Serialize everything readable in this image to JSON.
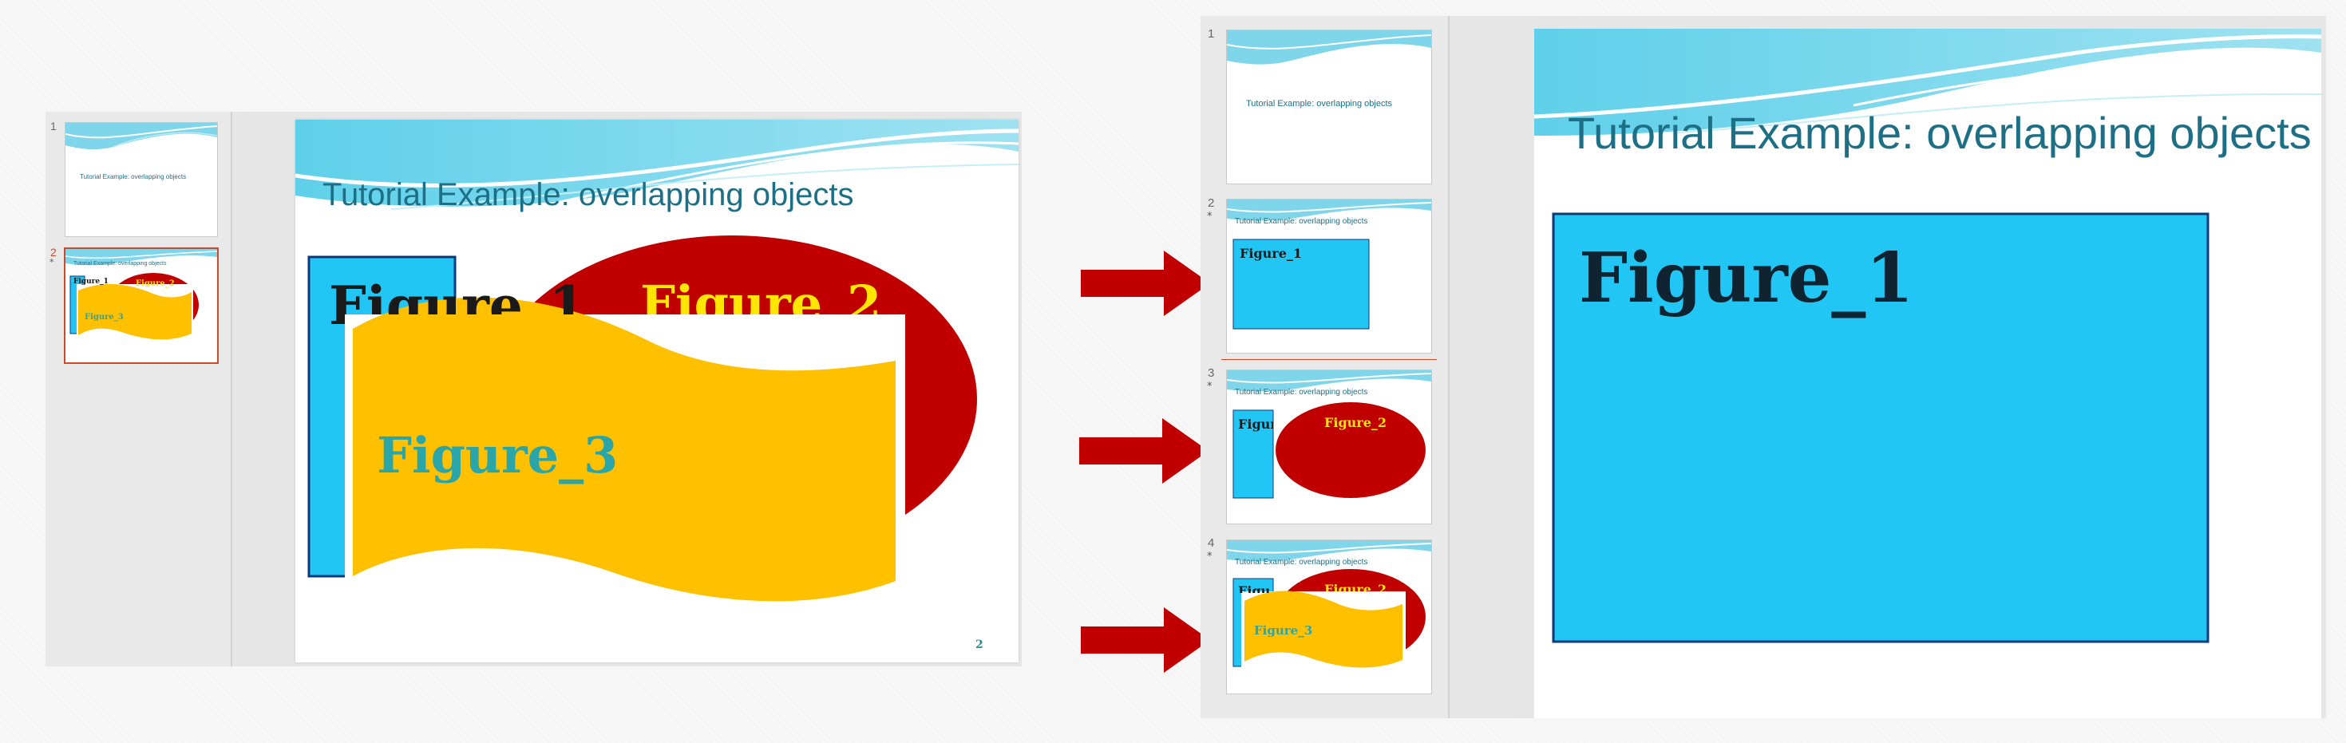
{
  "common": {
    "slide_title": "Tutorial Example: overlapping objects",
    "figure_1": "Figure_1",
    "figure_2": "Figure_2",
    "figure_3": "Figure_3",
    "page_number_2": "2"
  },
  "left_editor": {
    "thumbnails": [
      {
        "number": "1",
        "selected": false
      },
      {
        "number": "2",
        "selected": true,
        "has_animation": "*"
      }
    ]
  },
  "right_editor": {
    "thumbnails": [
      {
        "number": "1"
      },
      {
        "number": "2",
        "has_animation": "*"
      },
      {
        "number": "3",
        "has_animation": "*"
      },
      {
        "number": "4",
        "has_animation": "*"
      }
    ]
  },
  "colors": {
    "figure_1_fill": "#22c6f4",
    "figure_1_border": "#0b3a7a",
    "figure_2_fill": "#c00000",
    "figure_2_text": "#ffe600",
    "figure_3_fill": "#ffc000",
    "figure_3_text": "#2aa6a9",
    "title_text": "#1d6f86",
    "arrow": "#c00000",
    "selection": "#d24726"
  }
}
